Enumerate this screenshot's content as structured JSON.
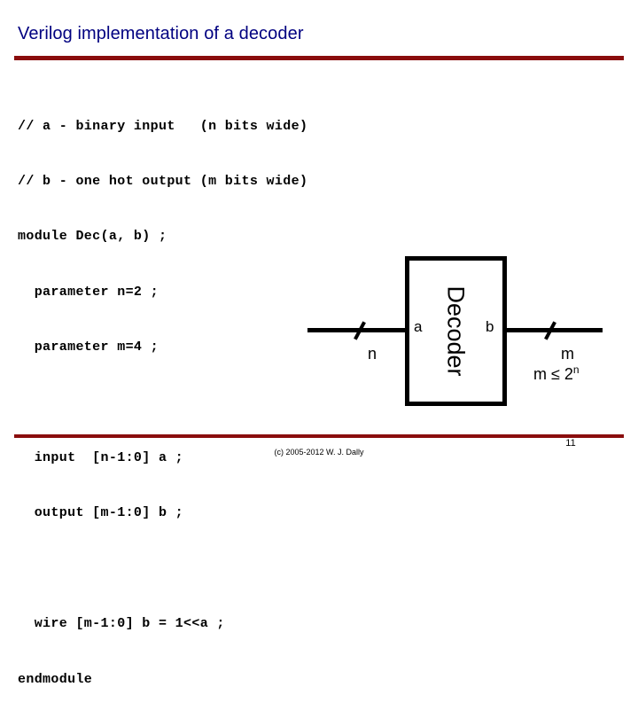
{
  "slide": {
    "title": "Verilog implementation of a decoder",
    "accent_color": "#8a0d0d",
    "title_color": "#000080",
    "background_color": "#ffffff"
  },
  "code": {
    "language": "verilog",
    "lines": [
      "// a - binary input   (n bits wide)",
      "// b - one hot output (m bits wide)",
      "module Dec(a, b) ;",
      "  parameter n=2 ;",
      "  parameter m=4 ;",
      "",
      "  input  [n-1:0] a ;",
      "  output [m-1:0] b ;",
      "",
      "  wire [m-1:0] b = 1<<a ;",
      "endmodule"
    ]
  },
  "diagram": {
    "block_label": "Decoder",
    "input_port_label": "a",
    "output_port_label": "b",
    "input_width_label": "n",
    "output_width_label": "m",
    "constraint_prefix": "m ≤ 2",
    "constraint_exponent": "n"
  },
  "footer": {
    "copyright": "(c) 2005-2012 W. J. Dally",
    "page_number": "11"
  }
}
